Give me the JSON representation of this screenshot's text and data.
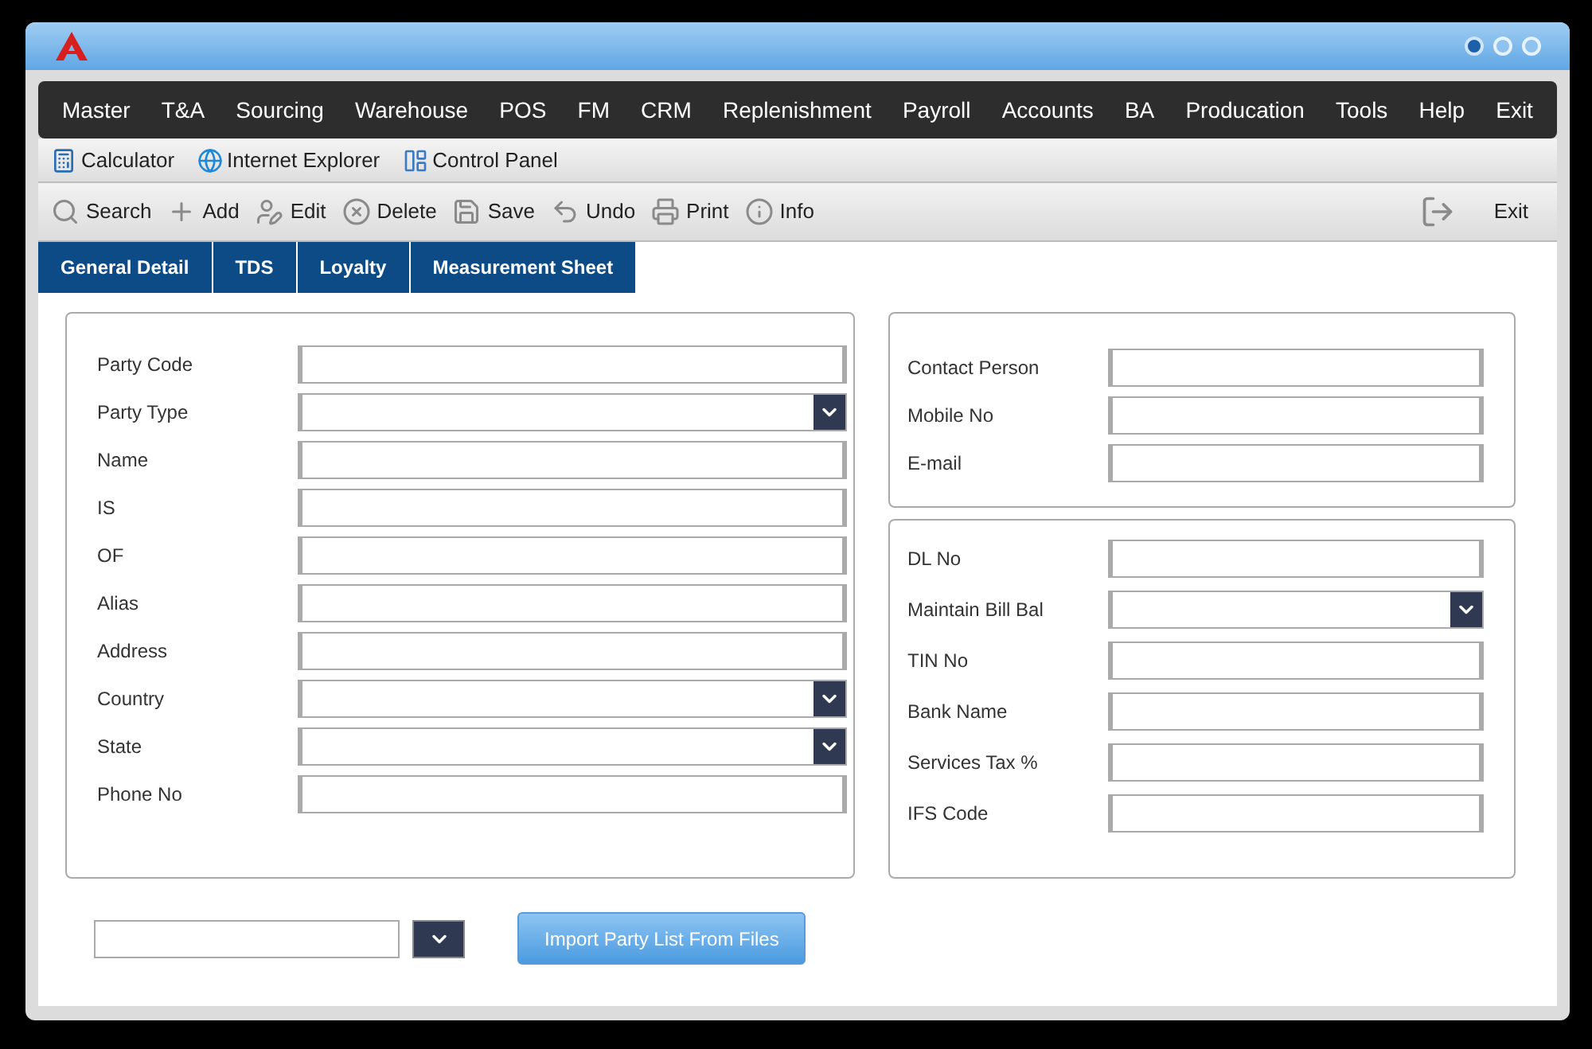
{
  "menu": [
    "Master",
    "T&A",
    "Sourcing",
    "Warehouse",
    "POS",
    "FM",
    "CRM",
    "Replenishment",
    "Payroll",
    "Accounts",
    "BA",
    "Producation",
    "Tools",
    "Help",
    "Exit"
  ],
  "quick_launch": [
    {
      "label": "Calculator",
      "kind": "calculator"
    },
    {
      "label": "Internet Explorer",
      "kind": "browser"
    },
    {
      "label": "Control Panel",
      "kind": "panel"
    }
  ],
  "toolbar": [
    {
      "label": "Search",
      "kind": "search"
    },
    {
      "label": "Add",
      "kind": "add"
    },
    {
      "label": "Edit",
      "kind": "edit"
    },
    {
      "label": "Delete",
      "kind": "delete"
    },
    {
      "label": "Save",
      "kind": "save"
    },
    {
      "label": "Undo",
      "kind": "undo"
    },
    {
      "label": "Print",
      "kind": "print"
    },
    {
      "label": "Info",
      "kind": "info"
    }
  ],
  "exit_button": "Exit",
  "tabs": [
    "General Detail",
    "TDS",
    "Loyalty",
    "Measurement Sheet"
  ],
  "left_panel": [
    {
      "label": "Party Code",
      "kind": "text"
    },
    {
      "label": "Party Type",
      "kind": "select"
    },
    {
      "label": "Name",
      "kind": "text"
    },
    {
      "label": "IS",
      "kind": "text"
    },
    {
      "label": "OF",
      "kind": "text"
    },
    {
      "label": "Alias",
      "kind": "text"
    },
    {
      "label": "Address",
      "kind": "text"
    },
    {
      "label": "Country",
      "kind": "select"
    },
    {
      "label": "State",
      "kind": "select"
    },
    {
      "label": "Phone No",
      "kind": "text"
    }
  ],
  "contact_panel": [
    {
      "label": "Contact Person",
      "kind": "text"
    },
    {
      "label": "Mobile No",
      "kind": "text"
    },
    {
      "label": "E-mail",
      "kind": "text"
    }
  ],
  "bank_panel": [
    {
      "label": "DL No",
      "kind": "text"
    },
    {
      "label": "Maintain Bill Bal",
      "kind": "select"
    },
    {
      "label": "TIN No",
      "kind": "text"
    },
    {
      "label": "Bank Name",
      "kind": "text"
    },
    {
      "label": "Services Tax %",
      "kind": "text"
    },
    {
      "label": "IFS Code",
      "kind": "text"
    }
  ],
  "import_button": "Import Party List From Files"
}
